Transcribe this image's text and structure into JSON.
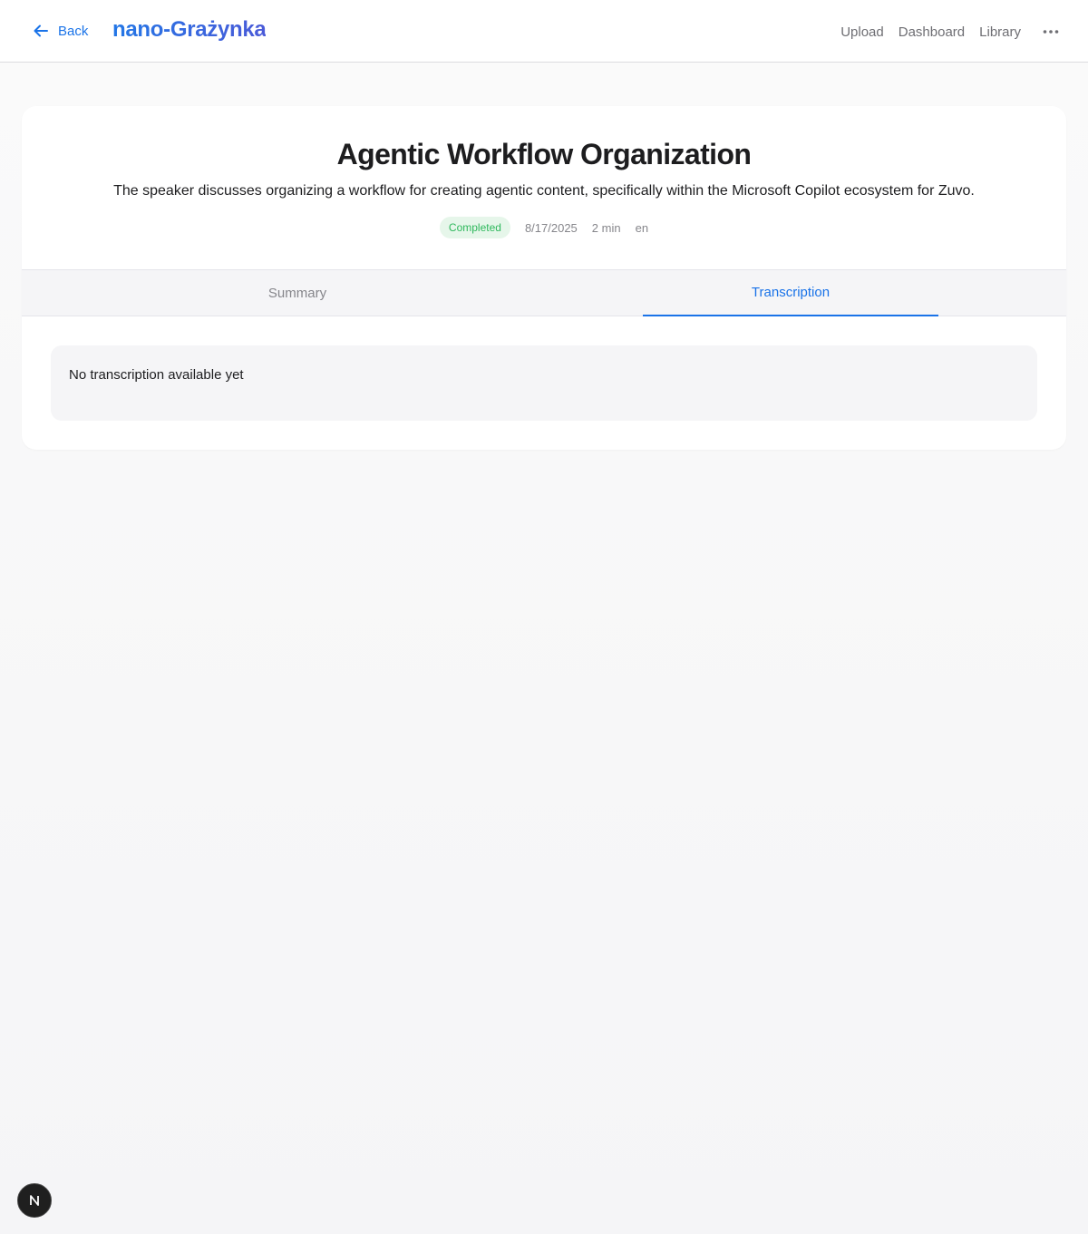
{
  "header": {
    "back_label": "Back",
    "brand": "nano-Grażynka",
    "nav": [
      "Upload",
      "Dashboard",
      "Library"
    ],
    "more_icon": "more-horizontal-icon",
    "back_icon": "arrow-left-icon"
  },
  "recording": {
    "title": "Agentic Workflow Organization",
    "description": "The speaker discusses organizing a workflow for creating agentic content, specifically within the Microsoft Copilot ecosystem for Zuvo.",
    "status": "Completed",
    "date": "8/17/2025",
    "duration": "2 min",
    "language": "en"
  },
  "tabs": {
    "summary": "Summary",
    "transcription": "Transcription",
    "active": "transcription"
  },
  "transcription": {
    "empty_message": "No transcription available yet"
  },
  "dev_badge": {
    "icon": "nextjs-logo-icon"
  },
  "colors": {
    "accent": "#1a73e8",
    "status_green": "#2eb85c",
    "status_bg": "#e6f6ea"
  }
}
